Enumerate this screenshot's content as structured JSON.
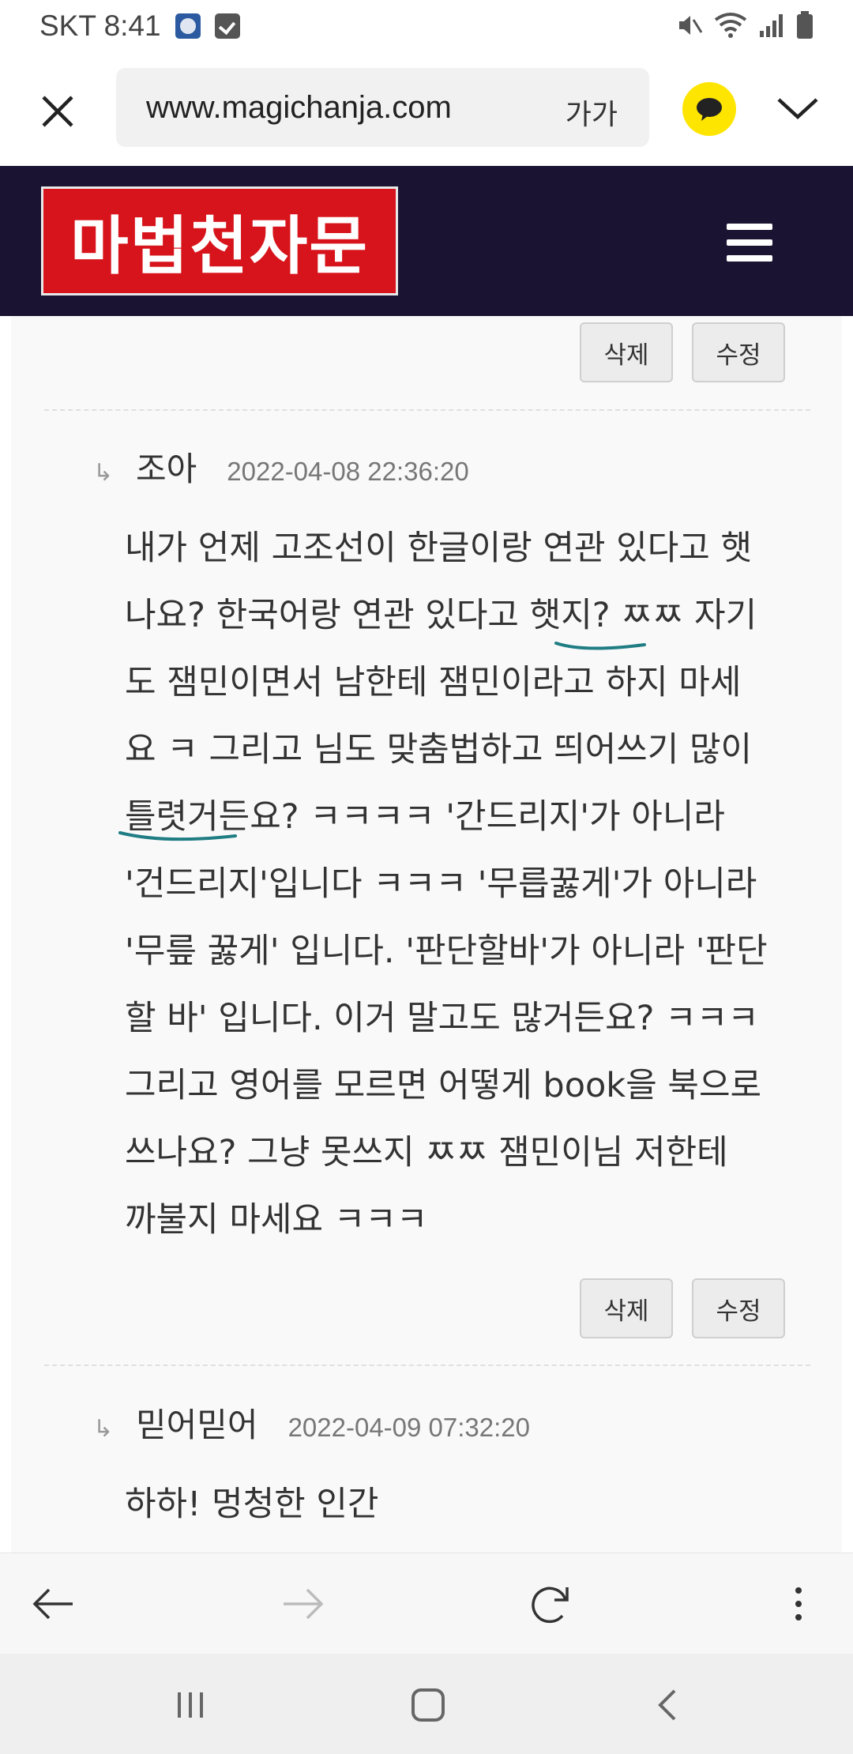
{
  "status_bar": {
    "carrier_time": "SKT 8:41"
  },
  "browser": {
    "url": "www.magichanja.com",
    "text_size_label": "가가"
  },
  "site": {
    "logo_text": "마법천자문",
    "logo_bg": "#d7141b",
    "header_bg": "#1a1432"
  },
  "comments": {
    "delete_label": "삭제",
    "edit_label": "수정",
    "reply_marker": "↳",
    "items": [
      {
        "author": "조아",
        "date": "2022-04-08 22:36:20",
        "lines": [
          "내가 언제 고조선이 한글이랑 연관 있다고 햇",
          "나요? 한국어랑 연관 있다고 햇지? ㅉㅉ 자기",
          "도 잼민이면서 남한테 잼민이라고 하지 마세",
          "요 ㅋ 그리고 님도 맞춤법하고 띄어쓰기 많이",
          "틀렷거든요? ㅋㅋㅋㅋ '간드리지'가 아니라",
          "'건드리지'입니다 ㅋㅋㅋ '무릅꿇게'가 아니라",
          "'무릎 꿇게' 입니다. '판단할바'가 아니라 '판단",
          "할 바' 입니다. 이거 말고도 많거든요? ㅋㅋㅋ",
          "그리고 영어를 모르면 어떻게 book을 북으로",
          "쓰나요? 그냥 못쓰지 ㅉㅉ 잼민이님 저한테",
          "까불지 마세요 ㅋㅋㅋ"
        ]
      },
      {
        "author": "믿어믿어",
        "date": "2022-04-09 07:32:20",
        "lines": [
          "하하! 멍청한 인간"
        ]
      }
    ]
  }
}
